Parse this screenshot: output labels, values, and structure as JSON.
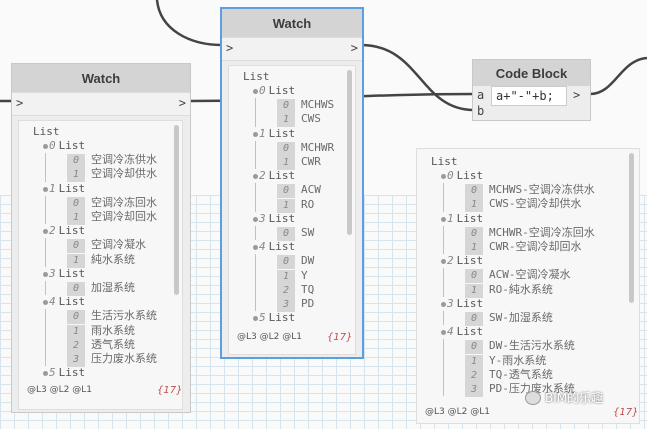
{
  "colors": {
    "wire": "#444444",
    "selection": "#5aa0e0",
    "count": "#c05050"
  },
  "watch1": {
    "title": "Watch",
    "in": ">",
    "out": ">",
    "footer": "@L3 @L2 @L1",
    "count": "{17}",
    "root": "List"
  },
  "watch2": {
    "title": "Watch",
    "in": ">",
    "out": ">",
    "footer": "@L3 @L2 @L1",
    "count": "{17}",
    "root": "List"
  },
  "code_block": {
    "title": "Code Block",
    "input_a": "a",
    "input_b": "b",
    "code": "a+\"-\"+b;",
    "out": ">"
  },
  "result": {
    "footer": "@L3 @L2 @L1",
    "count": "{17}",
    "root": "List"
  },
  "w1_lines": [
    {
      "t": "L",
      "label": "List",
      "i": "0"
    },
    {
      "t": "S",
      "i": "0",
      "v": "空调冷冻供水"
    },
    {
      "t": "S",
      "i": "1",
      "v": "空调冷却供水"
    },
    {
      "t": "L",
      "label": "List",
      "i": "1"
    },
    {
      "t": "S",
      "i": "0",
      "v": "空调冷冻回水"
    },
    {
      "t": "S",
      "i": "1",
      "v": "空调冷却回水"
    },
    {
      "t": "L",
      "label": "List",
      "i": "2"
    },
    {
      "t": "S",
      "i": "0",
      "v": "空调冷凝水"
    },
    {
      "t": "S",
      "i": "1",
      "v": "純水系统"
    },
    {
      "t": "L",
      "label": "List",
      "i": "3"
    },
    {
      "t": "S",
      "i": "0",
      "v": "加湿系统"
    },
    {
      "t": "L",
      "label": "List",
      "i": "4"
    },
    {
      "t": "S",
      "i": "0",
      "v": "生活污水系统"
    },
    {
      "t": "S",
      "i": "1",
      "v": "雨水系统"
    },
    {
      "t": "S",
      "i": "2",
      "v": "透气系统"
    },
    {
      "t": "S",
      "i": "3",
      "v": "压力废水系统"
    },
    {
      "t": "L",
      "label": "List",
      "i": "5"
    }
  ],
  "w2_lines": [
    {
      "t": "L",
      "label": "List",
      "i": "0"
    },
    {
      "t": "S",
      "i": "0",
      "v": "MCHWS"
    },
    {
      "t": "S",
      "i": "1",
      "v": "CWS"
    },
    {
      "t": "L",
      "label": "List",
      "i": "1"
    },
    {
      "t": "S",
      "i": "0",
      "v": "MCHWR"
    },
    {
      "t": "S",
      "i": "1",
      "v": "CWR"
    },
    {
      "t": "L",
      "label": "List",
      "i": "2"
    },
    {
      "t": "S",
      "i": "0",
      "v": "ACW"
    },
    {
      "t": "S",
      "i": "1",
      "v": "RO"
    },
    {
      "t": "L",
      "label": "List",
      "i": "3"
    },
    {
      "t": "S",
      "i": "0",
      "v": "SW"
    },
    {
      "t": "L",
      "label": "List",
      "i": "4"
    },
    {
      "t": "S",
      "i": "0",
      "v": "DW"
    },
    {
      "t": "S",
      "i": "1",
      "v": "Y"
    },
    {
      "t": "S",
      "i": "2",
      "v": "TQ"
    },
    {
      "t": "S",
      "i": "3",
      "v": "PD"
    },
    {
      "t": "L",
      "label": "List",
      "i": "5"
    }
  ],
  "r_lines": [
    {
      "t": "L",
      "label": "List",
      "i": "0"
    },
    {
      "t": "S",
      "i": "0",
      "v": "MCHWS-空调冷冻供水"
    },
    {
      "t": "S",
      "i": "1",
      "v": "CWS-空调冷却供水"
    },
    {
      "t": "L",
      "label": "List",
      "i": "1"
    },
    {
      "t": "S",
      "i": "0",
      "v": "MCHWR-空调冷冻回水"
    },
    {
      "t": "S",
      "i": "1",
      "v": "CWR-空调冷却回水"
    },
    {
      "t": "L",
      "label": "List",
      "i": "2"
    },
    {
      "t": "S",
      "i": "0",
      "v": "ACW-空调冷凝水"
    },
    {
      "t": "S",
      "i": "1",
      "v": "RO-純水系统"
    },
    {
      "t": "L",
      "label": "List",
      "i": "3"
    },
    {
      "t": "S",
      "i": "0",
      "v": "SW-加湿系统"
    },
    {
      "t": "L",
      "label": "List",
      "i": "4"
    },
    {
      "t": "S",
      "i": "0",
      "v": "DW-生活污水系统"
    },
    {
      "t": "S",
      "i": "1",
      "v": "Y-雨水系统"
    },
    {
      "t": "S",
      "i": "2",
      "v": "TQ-透气系统"
    },
    {
      "t": "S",
      "i": "3",
      "v": "PD-压力废水系统"
    }
  ],
  "watermark": {
    "text": "BIM的乐趣",
    "icon": "wechat-icon"
  }
}
